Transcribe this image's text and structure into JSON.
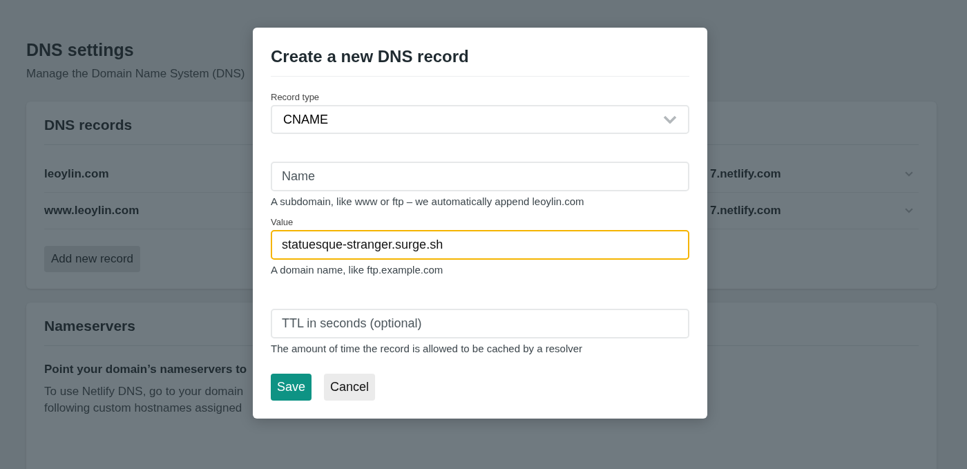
{
  "page": {
    "title": "DNS settings",
    "subtitle": "Manage the Domain Name System (DNS)"
  },
  "dns_records": {
    "title": "DNS records",
    "records": [
      {
        "name": "leoylin.com",
        "value": "7.netlify.com"
      },
      {
        "name": "www.leoylin.com",
        "value": "7.netlify.com"
      }
    ],
    "add_button": "Add new record"
  },
  "nameservers": {
    "title": "Nameservers",
    "heading": "Point your domain’s nameservers to",
    "lines": [
      "To use Netlify DNS, go to your domain",
      "following custom hostnames assigned"
    ]
  },
  "dialog": {
    "title": "Create a new DNS record",
    "fields": [
      {
        "kind": "select",
        "label": "Record type",
        "value": "CNAME"
      },
      {
        "kind": "input",
        "placeholder": "Name",
        "help": "A subdomain, like www or ftp – we automatically append leoylin.com",
        "focused": false
      },
      {
        "kind": "input",
        "label": "Value",
        "value": "statuesque-stranger.surge.sh",
        "help": "A domain name, like ftp.example.com",
        "focused": true
      },
      {
        "kind": "input",
        "placeholder": "TTL in seconds (optional)",
        "help": "The amount of time the record is allowed to be cached by a resolver",
        "focused": false
      }
    ],
    "buttons": [
      {
        "label": "Save",
        "primary": true
      },
      {
        "label": "Cancel",
        "primary": false
      }
    ]
  }
}
